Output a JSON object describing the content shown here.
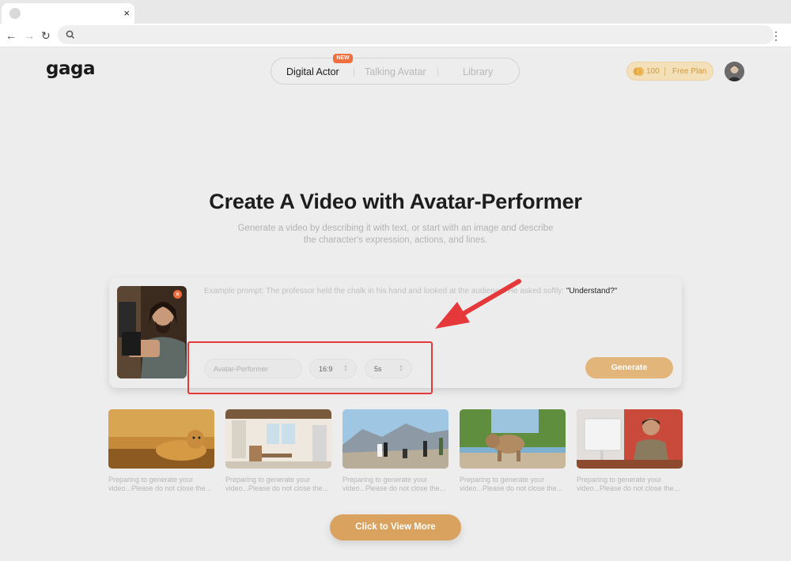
{
  "browser": {
    "tab_close_glyph": "×",
    "back_glyph": "←",
    "forward_glyph": "→",
    "reload_glyph": "↻",
    "menu_glyph": "⋮"
  },
  "header": {
    "logo": "gaga",
    "nav_tabs": [
      {
        "label": "Digital Actor",
        "active": true
      },
      {
        "label": "Talking Avatar",
        "active": false
      },
      {
        "label": "Library",
        "active": false
      }
    ],
    "new_badge": "NEW",
    "credits_count": "100",
    "plan_label": "Free Plan"
  },
  "hero": {
    "title": "Create A Video with Avatar-Performer",
    "subtitle": "Generate a video by describing it with text, or start with an image and describe the character's expression, actions, and lines."
  },
  "prompt": {
    "remove_glyph": "×",
    "placeholder_text": "Example prompt: The professor held the chalk in his hand and looked at the audience. He asked softly: ",
    "placeholder_quote": "\"Understand?\"",
    "model_select": "Avatar-Performer",
    "ratio_select": "16:9",
    "duration_select": "5s",
    "caret_glyph": "▲▼",
    "generate_label": "Generate"
  },
  "gallery": {
    "items": [
      {
        "icon": "cheetah-image",
        "caption": "Preparing to generate your video...Please do not close the..."
      },
      {
        "icon": "kitchen-image",
        "caption": "Preparing to generate your video...Please do not close the..."
      },
      {
        "icon": "mountain-wedding-image",
        "caption": "Preparing to generate your video...Please do not close the..."
      },
      {
        "icon": "monkey-image",
        "caption": "Preparing to generate your video...Please do not close the..."
      },
      {
        "icon": "man-at-desk-image",
        "caption": "Preparing to generate your video...Please do not close the..."
      }
    ]
  },
  "view_more_label": "Click to View More",
  "colors": {
    "accent": "#e2b57a",
    "view_more": "#d9a25f",
    "new_badge": "#ef6f3f",
    "highlight": "#e5383b"
  }
}
